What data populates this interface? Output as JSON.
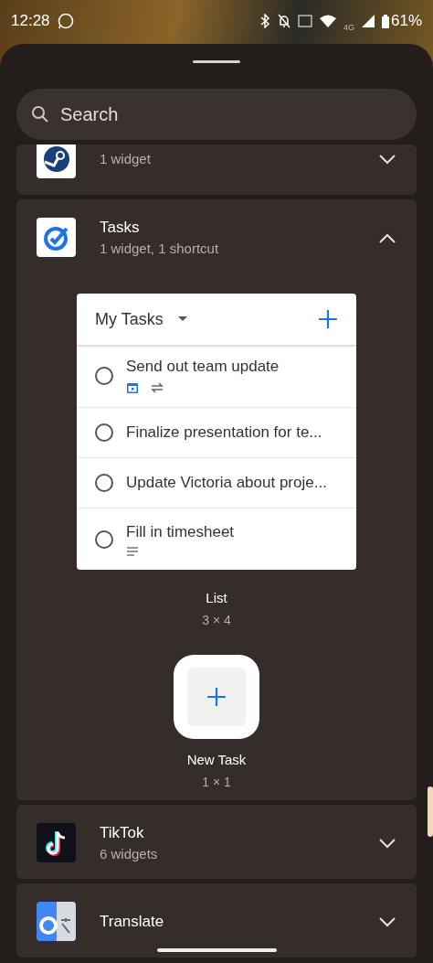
{
  "status_bar": {
    "time": "12:28",
    "network": "4G",
    "battery": "61%"
  },
  "search": {
    "placeholder": "Search"
  },
  "apps": [
    {
      "subtitle": "1 widget",
      "expanded": false
    },
    {
      "name": "Tasks",
      "subtitle": "1 widget, 1 shortcut",
      "expanded": true,
      "previews": [
        {
          "kind": "task-list",
          "header": "My Tasks",
          "tasks": [
            {
              "title": "Send out team update",
              "checked": false,
              "due_date": true,
              "repeating": true,
              "notes": false
            },
            {
              "title": "Finalize presentation for te...",
              "checked": false,
              "due_date": false,
              "repeating": false,
              "notes": false
            },
            {
              "title": "Update Victoria about proje...",
              "checked": false,
              "due_date": false,
              "repeating": false,
              "notes": false
            },
            {
              "title": "Fill in timesheet",
              "checked": false,
              "due_date": false,
              "repeating": false,
              "notes": true
            }
          ],
          "label": "List",
          "size": "3 × 4"
        },
        {
          "kind": "shortcut",
          "label": "New Task",
          "size": "1 × 1"
        }
      ]
    },
    {
      "name": "TikTok",
      "subtitle": "6 widgets",
      "expanded": false
    },
    {
      "name": "Translate",
      "expanded": false
    }
  ]
}
